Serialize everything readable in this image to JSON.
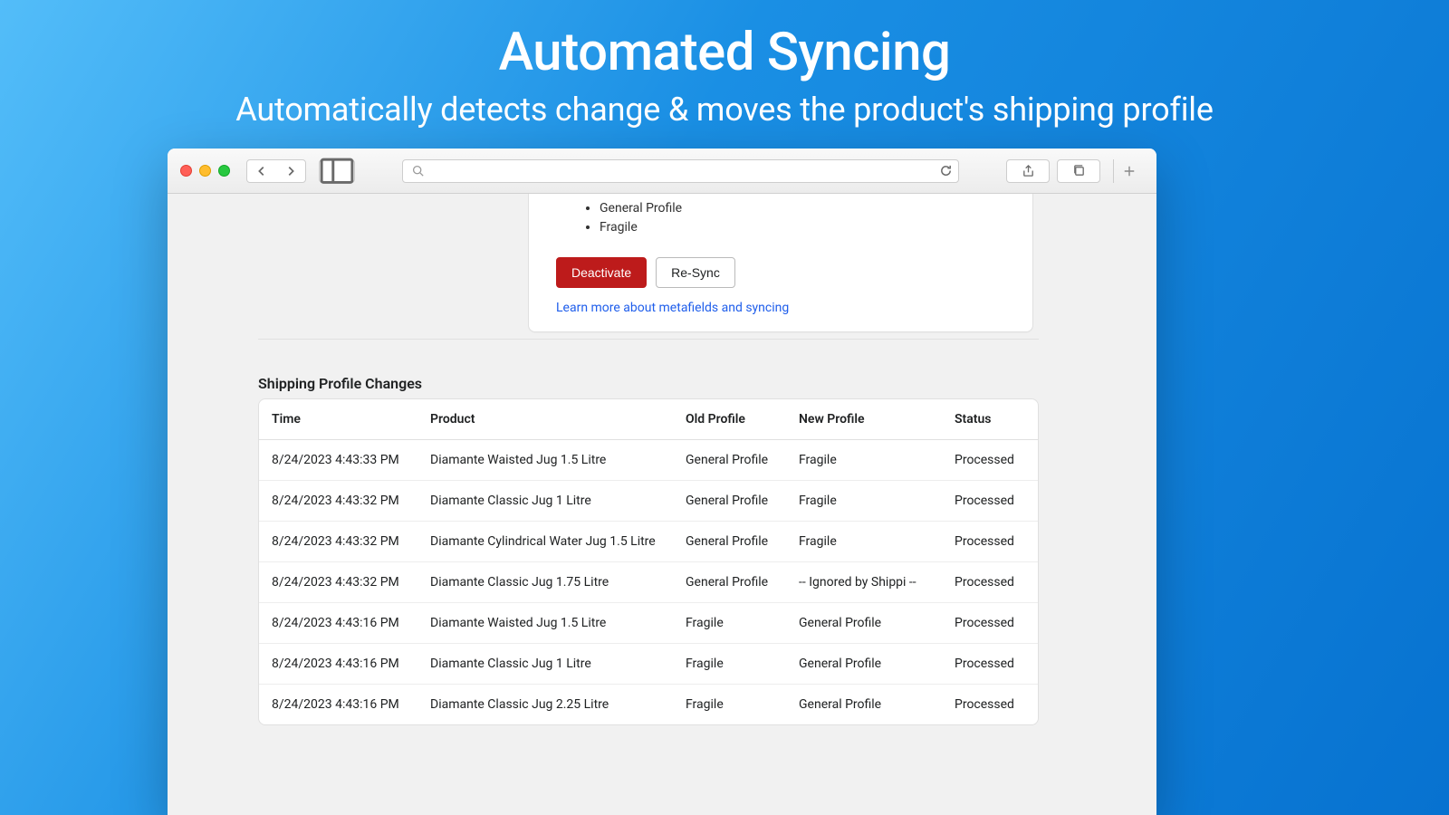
{
  "hero": {
    "title": "Automated Syncing",
    "subtitle": "Automatically detects change & moves the product's shipping profile"
  },
  "chrome": {
    "search_placeholder": ""
  },
  "panel": {
    "profiles": [
      "General Profile",
      "Fragile"
    ],
    "deactivate_label": "Deactivate",
    "resync_label": "Re-Sync",
    "learn_link": "Learn more about metafields and syncing"
  },
  "table": {
    "title": "Shipping Profile Changes",
    "headers": {
      "time": "Time",
      "product": "Product",
      "old": "Old Profile",
      "new": "New Profile",
      "status": "Status"
    },
    "rows": [
      {
        "time": "8/24/2023 4:43:33 PM",
        "product": "Diamante Waisted Jug 1.5 Litre",
        "old": "General Profile",
        "new": "Fragile",
        "status": "Processed"
      },
      {
        "time": "8/24/2023 4:43:32 PM",
        "product": "Diamante Classic Jug 1 Litre",
        "old": "General Profile",
        "new": "Fragile",
        "status": "Processed"
      },
      {
        "time": "8/24/2023 4:43:32 PM",
        "product": "Diamante Cylindrical Water Jug 1.5 Litre",
        "old": "General Profile",
        "new": "Fragile",
        "status": "Processed"
      },
      {
        "time": "8/24/2023 4:43:32 PM",
        "product": "Diamante Classic Jug 1.75 Litre",
        "old": "General Profile",
        "new": "-- Ignored by Shippi --",
        "status": "Processed"
      },
      {
        "time": "8/24/2023 4:43:16 PM",
        "product": "Diamante Waisted Jug 1.5 Litre",
        "old": "Fragile",
        "new": "General Profile",
        "status": "Processed"
      },
      {
        "time": "8/24/2023 4:43:16 PM",
        "product": "Diamante Classic Jug 1 Litre",
        "old": "Fragile",
        "new": "General Profile",
        "status": "Processed"
      },
      {
        "time": "8/24/2023 4:43:16 PM",
        "product": "Diamante Classic Jug 2.25 Litre",
        "old": "Fragile",
        "new": "General Profile",
        "status": "Processed"
      }
    ]
  }
}
